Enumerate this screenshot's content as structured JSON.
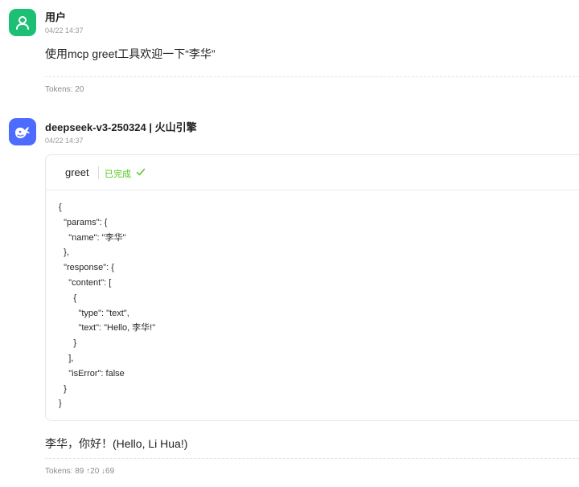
{
  "user_message": {
    "sender": "用户",
    "time": "04/22 14:37",
    "text": "使用mcp greet工具欢迎一下“李华”",
    "tokens": "Tokens: 20",
    "avatar_icon": "user-icon",
    "avatar_color": "#1cbf73"
  },
  "assistant_message": {
    "sender": "deepseek-v3-250324 | 火山引擎",
    "time": "04/22 14:37",
    "avatar_icon": "whale-icon",
    "avatar_color": "#4d6bfe",
    "tool_call": {
      "name": "greet",
      "status": "已完成",
      "status_color": "#52c41a",
      "status_icon": "check-icon",
      "output": "{\n  \"params\": {\n    \"name\": \"李华\"\n  },\n  \"response\": {\n    \"content\": [\n      {\n        \"type\": \"text\",\n        \"text\": \"Hello, 李华!\"\n      }\n    ],\n    \"isError\": false\n  }\n}"
    },
    "text": "李华，你好！(Hello, Li Hua!)",
    "tokens": "Tokens: 89 ↑20 ↓69"
  }
}
